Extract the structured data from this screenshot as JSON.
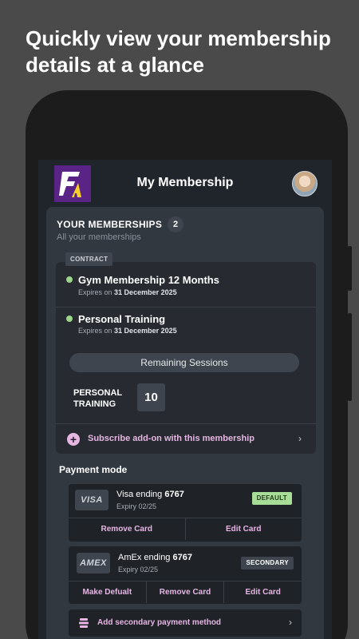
{
  "headline": "Quickly view your membership details at a glance",
  "app": {
    "title": "My Membership",
    "logo_icon": "brand-bolt-logo",
    "avatar_icon": "user-avatar"
  },
  "memberships": {
    "section_title": "YOUR MEMBERSHIPS",
    "count": "2",
    "subtitle": "All your memberships",
    "tag": "CONTRACT",
    "items": [
      {
        "name": "Gym Membership 12 Months",
        "expires_prefix": "Expires on",
        "expires_date": "31 December 2025"
      },
      {
        "name": "Personal Training",
        "expires_prefix": "Expires on",
        "expires_date": "31 December 2025"
      }
    ],
    "remaining_label": "Remaining Sessions",
    "sessions_label_line1": "PERSONAL",
    "sessions_label_line2": "TRAINING",
    "sessions_count": "10",
    "addon_label": "Subscribe add-on with this membership"
  },
  "payment": {
    "title": "Payment mode",
    "cards": [
      {
        "brand": "VISA",
        "name_prefix": "Visa ending",
        "last4": "6767",
        "expiry": "Expiry 02/25",
        "badge": "DEFAULT",
        "actions": [
          "Remove Card",
          "Edit Card"
        ]
      },
      {
        "brand": "AMEX",
        "name_prefix": "AmEx ending",
        "last4": "6767",
        "expiry": "Expiry 02/25",
        "badge": "SECONDARY",
        "actions": [
          "Make Defualt",
          "Remove Card",
          "Edit Card"
        ]
      }
    ],
    "add_secondary_label": "Add secondary payment method"
  },
  "colors": {
    "accent": "#e6b6e3",
    "active_dot": "#9ad58a",
    "default_badge": "#a8dd97",
    "brand_purple": "#5a2486"
  }
}
